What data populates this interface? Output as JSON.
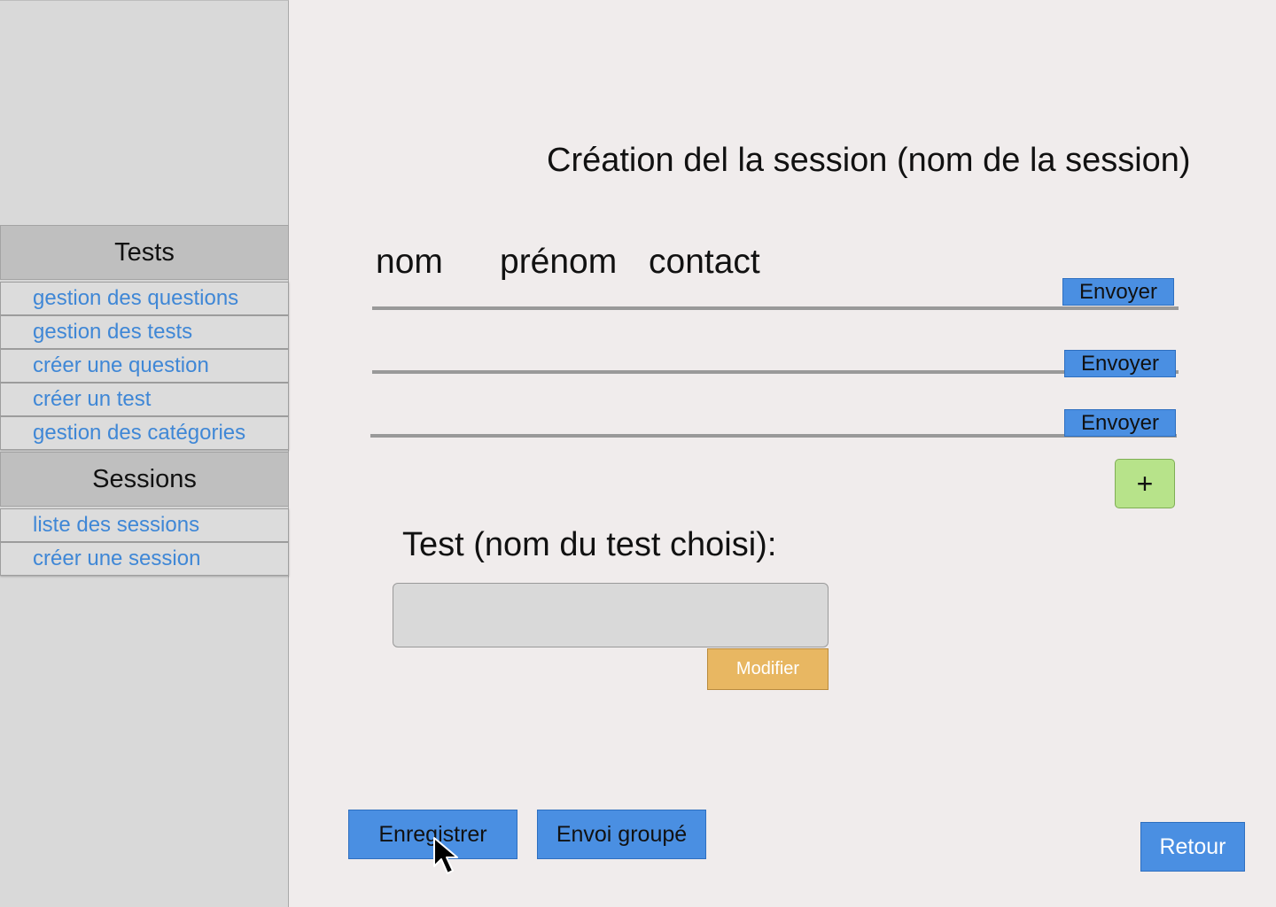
{
  "sidebar": {
    "sections": [
      {
        "title": "Tests",
        "items": [
          {
            "label": "gestion des questions"
          },
          {
            "label": "gestion des tests"
          },
          {
            "label": "créer une question"
          },
          {
            "label": "créer un test"
          },
          {
            "label": "gestion des catégories"
          }
        ]
      },
      {
        "title": "Sessions",
        "items": [
          {
            "label": "liste des sessions"
          },
          {
            "label": "créer une session"
          }
        ]
      }
    ]
  },
  "main": {
    "title": "Création del la session (nom de la session)",
    "columns": [
      "nom",
      "prénom",
      "contact"
    ],
    "rows": [
      {
        "send_label": "Envoyer"
      },
      {
        "send_label": "Envoyer"
      },
      {
        "send_label": "Envoyer"
      }
    ],
    "add_label": "+",
    "test_label": "Test (nom du test choisi):",
    "test_value": "",
    "modify_label": "Modifier",
    "save_label": "Enregistrer",
    "group_send_label": "Envoi groupé",
    "back_label": "Retour"
  },
  "colors": {
    "background": "#f0ecec",
    "sidebar": "#d9d9d9",
    "link": "#3f87d6",
    "primary_button": "#4a8fe2",
    "add_button": "#b7e38a",
    "modify_button": "#e8b762"
  }
}
